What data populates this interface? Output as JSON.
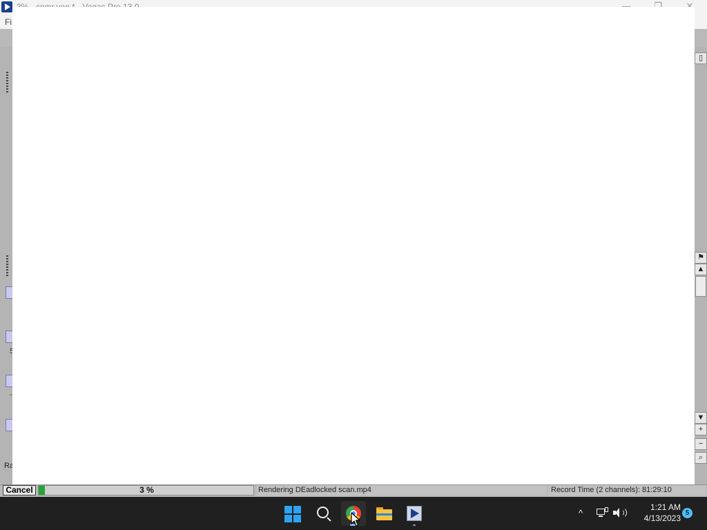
{
  "vegas": {
    "title": "3% - cnmr.veg * - Vegas Pro 13.0",
    "menu_file": "Fi",
    "rate_label": "Ra",
    "track_texts": [
      "5",
      "-"
    ],
    "controls": {
      "minimize": "—",
      "restore": "❐",
      "close": "✕"
    }
  },
  "render": {
    "cancel_label": "Cancel",
    "progress": 0.03,
    "progress_label": "3 %",
    "status_text": "Rendering DEadlocked scan.mp4",
    "record_time": "Record Time (2 channels): 81:29:10",
    "progress_color": "#22a535"
  },
  "taskbar": {
    "apps": [
      "start",
      "search",
      "chrome",
      "file-explorer",
      "vegas-pro"
    ],
    "tray_chevron": "^",
    "clock_time": "1:21 AM",
    "clock_date": "4/13/2023",
    "notification_count": "5"
  },
  "right_panel_buttons": [
    "▲",
    "▼",
    "+",
    "−"
  ]
}
